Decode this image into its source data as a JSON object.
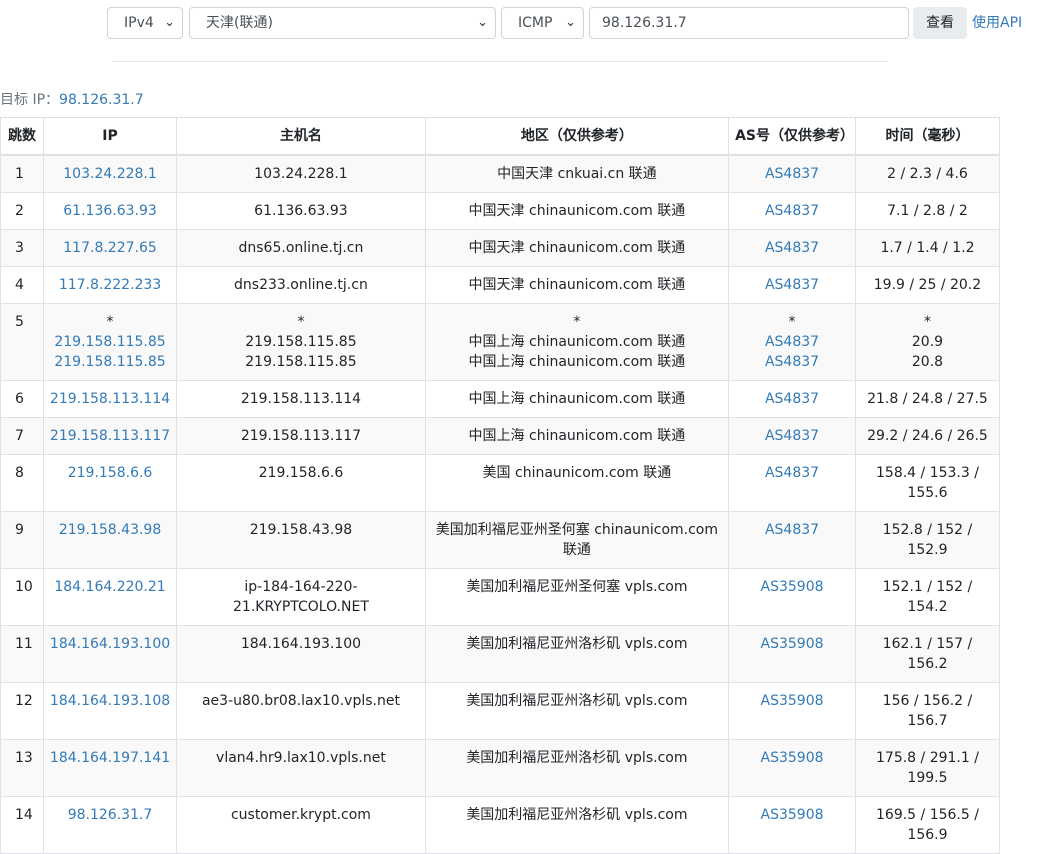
{
  "toolbar": {
    "ip_version": "IPv4",
    "node": "天津(联通)",
    "protocol": "ICMP",
    "ip_value": "98.126.31.7",
    "view_button": "查看",
    "api_link": "使用API"
  },
  "target": {
    "label": "目标 IP：",
    "value": "98.126.31.7"
  },
  "table": {
    "headers": {
      "hop": "跳数",
      "ip": "IP",
      "host": "主机名",
      "region": "地区（仅供参考）",
      "as": "AS号（仅供参考）",
      "time": "时间（毫秒）"
    },
    "rows": [
      {
        "hop": "1",
        "ip": [
          "103.24.228.1"
        ],
        "host": [
          "103.24.228.1"
        ],
        "region": [
          "中国天津 cnkuai.cn 联通"
        ],
        "as": [
          "AS4837"
        ],
        "time": [
          "2 / 2.3 / 4.6"
        ]
      },
      {
        "hop": "2",
        "ip": [
          "61.136.63.93"
        ],
        "host": [
          "61.136.63.93"
        ],
        "region": [
          "中国天津 chinaunicom.com 联通"
        ],
        "as": [
          "AS4837"
        ],
        "time": [
          "7.1 / 2.8 / 2"
        ]
      },
      {
        "hop": "3",
        "ip": [
          "117.8.227.65"
        ],
        "host": [
          "dns65.online.tj.cn"
        ],
        "region": [
          "中国天津 chinaunicom.com 联通"
        ],
        "as": [
          "AS4837"
        ],
        "time": [
          "1.7 / 1.4 / 1.2"
        ]
      },
      {
        "hop": "4",
        "ip": [
          "117.8.222.233"
        ],
        "host": [
          "dns233.online.tj.cn"
        ],
        "region": [
          "中国天津 chinaunicom.com 联通"
        ],
        "as": [
          "AS4837"
        ],
        "time": [
          "19.9 / 25 / 20.2"
        ]
      },
      {
        "hop": "5",
        "ip": [
          "*",
          "219.158.115.85",
          "219.158.115.85"
        ],
        "host": [
          "*",
          "219.158.115.85",
          "219.158.115.85"
        ],
        "region": [
          "*",
          "中国上海 chinaunicom.com 联通",
          "中国上海 chinaunicom.com 联通"
        ],
        "as": [
          "*",
          "AS4837",
          "AS4837"
        ],
        "time": [
          "*",
          "20.9",
          "20.8"
        ]
      },
      {
        "hop": "6",
        "ip": [
          "219.158.113.114"
        ],
        "host": [
          "219.158.113.114"
        ],
        "region": [
          "中国上海 chinaunicom.com 联通"
        ],
        "as": [
          "AS4837"
        ],
        "time": [
          "21.8 / 24.8 / 27.5"
        ]
      },
      {
        "hop": "7",
        "ip": [
          "219.158.113.117"
        ],
        "host": [
          "219.158.113.117"
        ],
        "region": [
          "中国上海 chinaunicom.com 联通"
        ],
        "as": [
          "AS4837"
        ],
        "time": [
          "29.2 / 24.6 / 26.5"
        ]
      },
      {
        "hop": "8",
        "ip": [
          "219.158.6.6"
        ],
        "host": [
          "219.158.6.6"
        ],
        "region": [
          "美国 chinaunicom.com 联通"
        ],
        "as": [
          "AS4837"
        ],
        "time": [
          "158.4 / 153.3 / 155.6"
        ]
      },
      {
        "hop": "9",
        "ip": [
          "219.158.43.98"
        ],
        "host": [
          "219.158.43.98"
        ],
        "region": [
          "美国加利福尼亚州圣何塞 chinaunicom.com 联通"
        ],
        "as": [
          "AS4837"
        ],
        "time": [
          "152.8 / 152 / 152.9"
        ]
      },
      {
        "hop": "10",
        "ip": [
          "184.164.220.21"
        ],
        "host": [
          "ip-184-164-220-21.KRYPTCOLO.NET"
        ],
        "region": [
          "美国加利福尼亚州圣何塞 vpls.com"
        ],
        "as": [
          "AS35908"
        ],
        "time": [
          "152.1 / 152 / 154.2"
        ]
      },
      {
        "hop": "11",
        "ip": [
          "184.164.193.100"
        ],
        "host": [
          "184.164.193.100"
        ],
        "region": [
          "美国加利福尼亚州洛杉矶 vpls.com"
        ],
        "as": [
          "AS35908"
        ],
        "time": [
          "162.1 / 157 / 156.2"
        ]
      },
      {
        "hop": "12",
        "ip": [
          "184.164.193.108"
        ],
        "host": [
          "ae3-u80.br08.lax10.vpls.net"
        ],
        "region": [
          "美国加利福尼亚州洛杉矶 vpls.com"
        ],
        "as": [
          "AS35908"
        ],
        "time": [
          "156 / 156.2 / 156.7"
        ]
      },
      {
        "hop": "13",
        "ip": [
          "184.164.197.141"
        ],
        "host": [
          "vlan4.hr9.lax10.vpls.net"
        ],
        "region": [
          "美国加利福尼亚州洛杉矶 vpls.com"
        ],
        "as": [
          "AS35908"
        ],
        "time": [
          "175.8 / 291.1 / 199.5"
        ]
      },
      {
        "hop": "14",
        "ip": [
          "98.126.31.7"
        ],
        "host": [
          "customer.krypt.com"
        ],
        "region": [
          "美国加利福尼亚州洛杉矶 vpls.com"
        ],
        "as": [
          "AS35908"
        ],
        "time": [
          "169.5 / 156.5 / 156.9"
        ]
      }
    ]
  }
}
